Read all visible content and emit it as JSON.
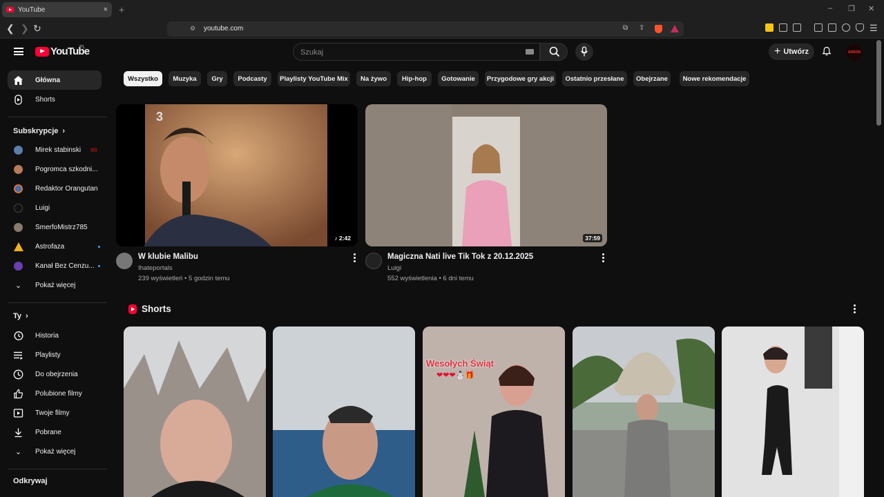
{
  "browser": {
    "tab_title": "YouTube",
    "tab_close": "×",
    "new_tab": "+",
    "url": "youtube.com",
    "window_controls": [
      "–",
      "❐",
      "✕"
    ]
  },
  "header": {
    "logo_text": "YouTube",
    "country_code": "PL",
    "search_placeholder": "Szukaj",
    "create_label": "Utwórz",
    "avatar_text": "ADRON"
  },
  "sidebar": {
    "main": [
      {
        "label": "Główna",
        "icon": "home-icon"
      },
      {
        "label": "Shorts",
        "icon": "shorts-icon"
      }
    ],
    "subscriptions_heading": "Subskrypcje",
    "subscriptions": [
      {
        "label": "Mirek stabinski",
        "indicator": "live"
      },
      {
        "label": "Pogromca szkodni...",
        "indicator": ""
      },
      {
        "label": "Redaktor Orangutan",
        "indicator": ""
      },
      {
        "label": "Luigi",
        "indicator": ""
      },
      {
        "label": "SmerfoMistrz785",
        "indicator": ""
      },
      {
        "label": "Astrofaza",
        "indicator": "new"
      },
      {
        "label": "Kanał Bez Cenzu...",
        "indicator": "new"
      }
    ],
    "show_more_1": "Pokaż więcej",
    "you_heading": "Ty",
    "you": [
      {
        "label": "Historia",
        "icon": "history-icon"
      },
      {
        "label": "Playlisty",
        "icon": "playlist-icon"
      },
      {
        "label": "Do obejrzenia",
        "icon": "watch-later-icon"
      },
      {
        "label": "Polubione filmy",
        "icon": "like-icon"
      },
      {
        "label": "Twoje filmy",
        "icon": "your-videos-icon"
      },
      {
        "label": "Pobrane",
        "icon": "download-icon"
      }
    ],
    "show_more_2": "Pokaż więcej",
    "explore_heading": "Odkrywaj"
  },
  "chips": [
    "Wszystko",
    "Muzyka",
    "Gry",
    "Podcasty",
    "Playlisty YouTube Mix",
    "Na żywo",
    "Hip-hop",
    "Gotowanie",
    "Przygodowe gry akcji",
    "Ostatnio przesłane",
    "Obejrzane",
    "Nowe rekomendacje"
  ],
  "videos": [
    {
      "title": "W klubie Malibu",
      "channel": "Ihateportals",
      "meta": "239 wyświetleń • 5 godzin temu",
      "duration": "♪ 2:42",
      "thumb_logo": "3"
    },
    {
      "title": "Magiczna Nati live Tik Tok z 20.12.2025",
      "channel": "Luigi",
      "meta": "552 wyświetlenia • 6 dni temu",
      "duration": "37:59"
    }
  ],
  "shorts": {
    "heading": "Shorts",
    "items": [
      {
        "overlay": ""
      },
      {
        "overlay": ""
      },
      {
        "overlay": "Wesołych Świąt",
        "overlay2": "❤❤❤⛄🎁"
      },
      {
        "overlay": ""
      },
      {
        "overlay": ""
      }
    ]
  },
  "colors": {
    "accent": "#ff0033",
    "background": "#0f0f0f",
    "chip": "#272727",
    "chip_selected": "#f1f1f1"
  }
}
